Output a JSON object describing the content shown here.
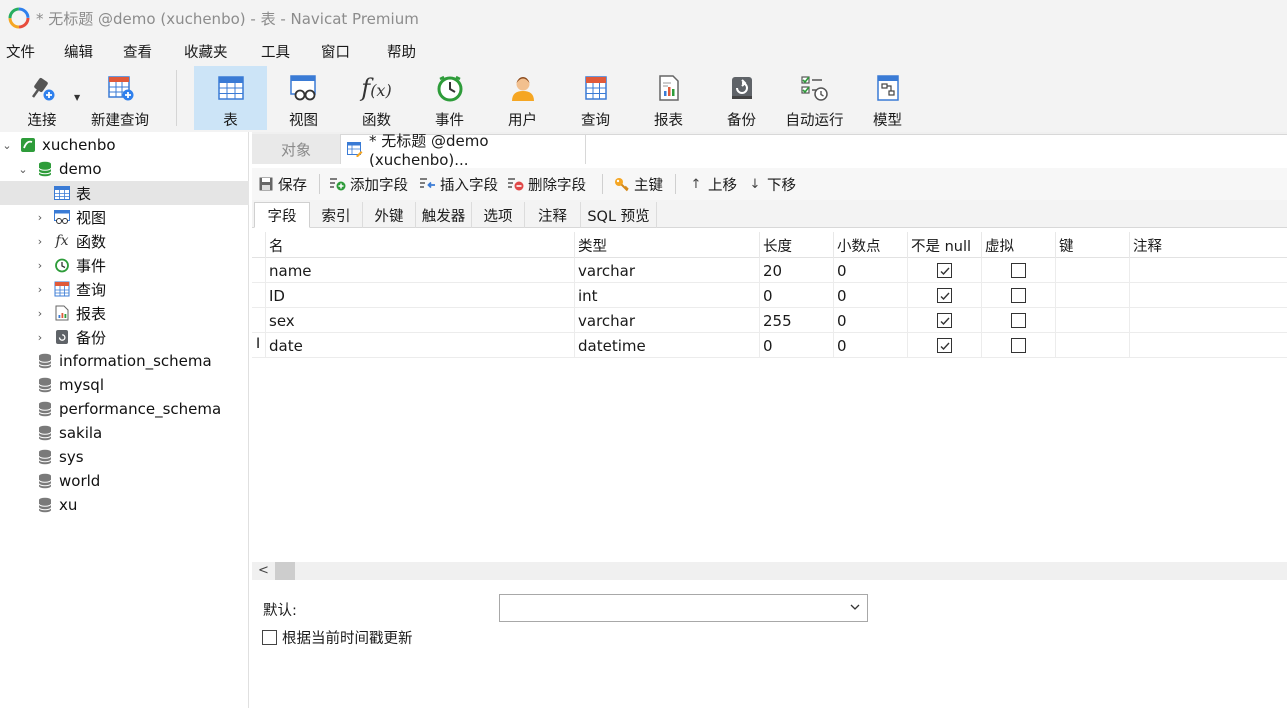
{
  "window": {
    "title": "* 无标题 @demo (xuchenbo) - 表 - Navicat Premium"
  },
  "menu": [
    "文件",
    "编辑",
    "查看",
    "收藏夹",
    "工具",
    "窗口",
    "帮助"
  ],
  "toolbar": {
    "buttons": [
      {
        "label": "连接",
        "icon": "plug-icon"
      },
      {
        "label": "新建查询",
        "icon": "new-query-icon"
      },
      {
        "label": "表",
        "icon": "table-icon",
        "active": true
      },
      {
        "label": "视图",
        "icon": "view-icon"
      },
      {
        "label": "函数",
        "icon": "function-icon"
      },
      {
        "label": "事件",
        "icon": "clock-icon"
      },
      {
        "label": "用户",
        "icon": "user-icon"
      },
      {
        "label": "查询",
        "icon": "query-icon"
      },
      {
        "label": "报表",
        "icon": "report-icon"
      },
      {
        "label": "备份",
        "icon": "backup-icon"
      },
      {
        "label": "自动运行",
        "icon": "schedule-icon"
      },
      {
        "label": "模型",
        "icon": "model-icon"
      }
    ]
  },
  "sidebar": {
    "connection": "xuchenbo",
    "database": "demo",
    "demo_children": [
      {
        "label": "表",
        "icon": "table-icon",
        "selected": true
      },
      {
        "label": "视图",
        "icon": "view-icon"
      },
      {
        "label": "函数",
        "icon": "function-icon"
      },
      {
        "label": "事件",
        "icon": "clock-icon"
      },
      {
        "label": "查询",
        "icon": "query-icon"
      },
      {
        "label": "报表",
        "icon": "report-icon"
      },
      {
        "label": "备份",
        "icon": "backup-icon"
      }
    ],
    "other_databases": [
      "information_schema",
      "mysql",
      "performance_schema",
      "sakila",
      "sys",
      "world",
      "xu"
    ]
  },
  "tabs": {
    "objects": "对象",
    "document": "* 无标题 @demo (xuchenbo)..."
  },
  "actions": {
    "save": "保存",
    "add_field": "添加字段",
    "insert_field": "插入字段",
    "delete_field": "删除字段",
    "primary_key": "主键",
    "move_up": "上移",
    "move_down": "下移"
  },
  "subtabs": [
    "字段",
    "索引",
    "外键",
    "触发器",
    "选项",
    "注释",
    "SQL 预览"
  ],
  "grid": {
    "headers": [
      "名",
      "类型",
      "长度",
      "小数点",
      "不是 null",
      "虚拟",
      "键",
      "注释"
    ],
    "rows": [
      {
        "name": "name",
        "type": "varchar",
        "length": "20",
        "decimals": "0",
        "not_null": true,
        "virtual": false
      },
      {
        "name": "ID",
        "type": "int",
        "length": "0",
        "decimals": "0",
        "not_null": true,
        "virtual": false
      },
      {
        "name": "sex",
        "type": "varchar",
        "length": "255",
        "decimals": "0",
        "not_null": true,
        "virtual": false
      },
      {
        "name": "date",
        "type": "datetime",
        "length": "0",
        "decimals": "0",
        "not_null": true,
        "virtual": false
      }
    ],
    "current_row_marker": "I"
  },
  "properties": {
    "default_label": "默认:",
    "default_value": "",
    "update_timestamp_label": "根据当前时间戳更新",
    "update_timestamp_checked": false
  },
  "colors": {
    "active_toolbar": "#cce4f7",
    "selected_tree_row": "#e5e5e5",
    "db_green": "#2e9c3a"
  }
}
